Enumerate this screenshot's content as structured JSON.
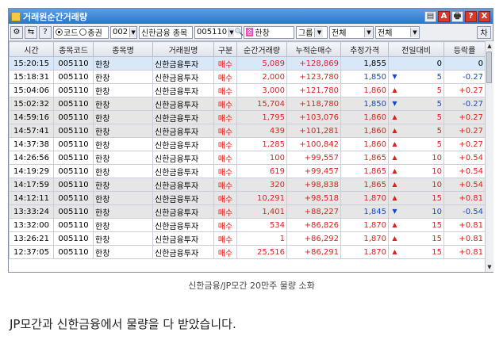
{
  "window": {
    "title": "거래원순간거래량",
    "title_buttons": [
      "▤",
      "A",
      "🖶",
      "?",
      "X"
    ]
  },
  "toolbar": {
    "radio_code": "코드",
    "radio_stock": "종권",
    "market_code": "002",
    "broker": "신한금융",
    "type_label": "종목",
    "stock_code": "005110",
    "stock_name": "한창",
    "group_label": "그룹",
    "filter1": "전체",
    "filter2": "전체",
    "right_button": "차"
  },
  "table": {
    "columns": [
      "시간",
      "종목코드",
      "종목명",
      "거래원명",
      "구분",
      "순간거래량",
      "누적순매수",
      "추정가격",
      "전일대비",
      "등락률"
    ],
    "rows": [
      {
        "time": "15:20:15",
        "code": "005110",
        "name": "한창",
        "broker": "신한금융투자",
        "side": "매수",
        "volume": "5,089",
        "cum": "+128,869",
        "price": "1,855",
        "dir": "",
        "change": "0",
        "rate": "0",
        "price_color": "black",
        "change_color": "black"
      },
      {
        "time": "15:18:31",
        "code": "005110",
        "name": "한창",
        "broker": "신한금융투자",
        "side": "매수",
        "volume": "2,000",
        "cum": "+123,780",
        "price": "1,850",
        "dir": "down",
        "change": "5",
        "rate": "-0.27",
        "price_color": "blue",
        "change_color": "blue"
      },
      {
        "time": "15:04:06",
        "code": "005110",
        "name": "한창",
        "broker": "신한금융투자",
        "side": "매수",
        "volume": "3,000",
        "cum": "+121,780",
        "price": "1,860",
        "dir": "up",
        "change": "5",
        "rate": "+0.27",
        "price_color": "red",
        "change_color": "red"
      },
      {
        "time": "15:02:32",
        "code": "005110",
        "name": "한창",
        "broker": "신한금융투자",
        "side": "매수",
        "volume": "15,704",
        "cum": "+118,780",
        "price": "1,850",
        "dir": "down",
        "change": "5",
        "rate": "-0.27",
        "price_color": "blue",
        "change_color": "blue"
      },
      {
        "time": "14:59:16",
        "code": "005110",
        "name": "한창",
        "broker": "신한금융투자",
        "side": "매수",
        "volume": "1,795",
        "cum": "+103,076",
        "price": "1,860",
        "dir": "up",
        "change": "5",
        "rate": "+0.27",
        "price_color": "red",
        "change_color": "red"
      },
      {
        "time": "14:57:41",
        "code": "005110",
        "name": "한창",
        "broker": "신한금융투자",
        "side": "매수",
        "volume": "439",
        "cum": "+101,281",
        "price": "1,860",
        "dir": "up",
        "change": "5",
        "rate": "+0.27",
        "price_color": "red",
        "change_color": "red"
      },
      {
        "time": "14:37:38",
        "code": "005110",
        "name": "한창",
        "broker": "신한금융투자",
        "side": "매수",
        "volume": "1,285",
        "cum": "+100,842",
        "price": "1,860",
        "dir": "up",
        "change": "5",
        "rate": "+0.27",
        "price_color": "red",
        "change_color": "red"
      },
      {
        "time": "14:26:56",
        "code": "005110",
        "name": "한창",
        "broker": "신한금융투자",
        "side": "매수",
        "volume": "100",
        "cum": "+99,557",
        "price": "1,865",
        "dir": "up",
        "change": "10",
        "rate": "+0.54",
        "price_color": "red",
        "change_color": "red"
      },
      {
        "time": "14:19:29",
        "code": "005110",
        "name": "한창",
        "broker": "신한금융투자",
        "side": "매수",
        "volume": "619",
        "cum": "+99,457",
        "price": "1,865",
        "dir": "up",
        "change": "10",
        "rate": "+0.54",
        "price_color": "red",
        "change_color": "red"
      },
      {
        "time": "14:17:59",
        "code": "005110",
        "name": "한창",
        "broker": "신한금융투자",
        "side": "매수",
        "volume": "320",
        "cum": "+98,838",
        "price": "1,865",
        "dir": "up",
        "change": "10",
        "rate": "+0.54",
        "price_color": "red",
        "change_color": "red"
      },
      {
        "time": "14:12:11",
        "code": "005110",
        "name": "한창",
        "broker": "신한금융투자",
        "side": "매수",
        "volume": "10,291",
        "cum": "+98,518",
        "price": "1,870",
        "dir": "up",
        "change": "15",
        "rate": "+0.81",
        "price_color": "red",
        "change_color": "red"
      },
      {
        "time": "13:33:24",
        "code": "005110",
        "name": "한창",
        "broker": "신한금융투자",
        "side": "매수",
        "volume": "1,401",
        "cum": "+88,227",
        "price": "1,845",
        "dir": "down",
        "change": "10",
        "rate": "-0.54",
        "price_color": "blue",
        "change_color": "blue"
      },
      {
        "time": "13:32:00",
        "code": "005110",
        "name": "한창",
        "broker": "신한금융투자",
        "side": "매수",
        "volume": "534",
        "cum": "+86,826",
        "price": "1,870",
        "dir": "up",
        "change": "15",
        "rate": "+0.81",
        "price_color": "red",
        "change_color": "red"
      },
      {
        "time": "13:26:21",
        "code": "005110",
        "name": "한창",
        "broker": "신한금융투자",
        "side": "매수",
        "volume": "1",
        "cum": "+86,292",
        "price": "1,870",
        "dir": "up",
        "change": "15",
        "rate": "+0.81",
        "price_color": "red",
        "change_color": "red"
      },
      {
        "time": "12:37:05",
        "code": "005110",
        "name": "한창",
        "broker": "신한금융투자",
        "side": "매수",
        "volume": "25,516",
        "cum": "+86,291",
        "price": "1,870",
        "dir": "up",
        "change": "15",
        "rate": "+0.81",
        "price_color": "red",
        "change_color": "red"
      }
    ],
    "gray_rows": [
      3,
      4,
      5,
      9,
      10,
      11
    ]
  },
  "caption": "신한금융/JP모간 20만주 물량 소화",
  "paragraph": "JP모간과 신한금융에서 물량을 다 받았습니다.",
  "colors": {
    "up": "#e0201c",
    "down": "#1646d6",
    "title_bar": "#2a74cc"
  }
}
